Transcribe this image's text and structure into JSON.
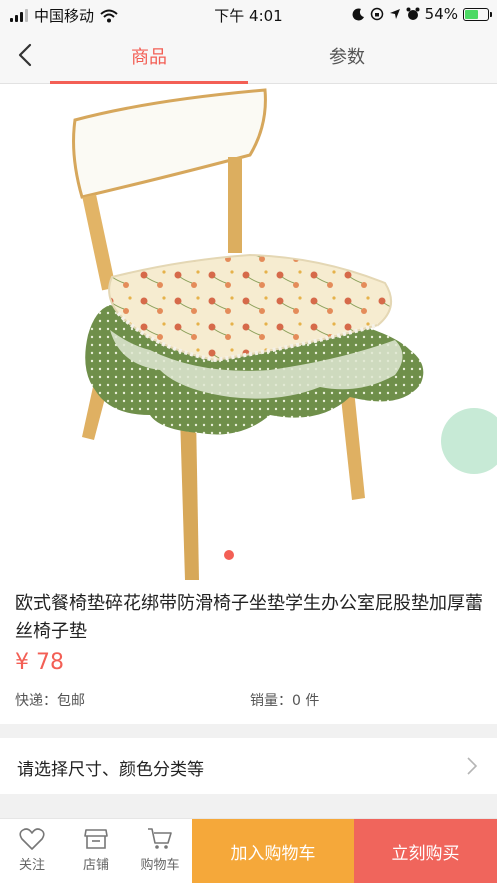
{
  "status_bar": {
    "carrier": "中国移动",
    "time": "下午 4:01",
    "battery": "54%",
    "battery_level": 0.54,
    "icons": [
      "signal-icon",
      "wifi-icon",
      "moon-icon",
      "lock-rotation-icon",
      "location-icon",
      "alarm-icon",
      "battery-icon"
    ]
  },
  "nav": {
    "tabs": [
      {
        "label": "商品",
        "active": true
      },
      {
        "label": "参数",
        "active": false
      }
    ]
  },
  "product": {
    "title": "欧式餐椅垫碎花绑带防滑椅子坐垫学生办公室屁股垫加厚蕾丝椅子垫",
    "price": "¥ 78",
    "shipping": "快递：包邮",
    "sales": "销量：0 件",
    "image_count_indicator": 1
  },
  "spec_selector": {
    "label": "请选择尺寸、颜色分类等"
  },
  "bottom_bar": {
    "follow": "关注",
    "shop": "店铺",
    "cart": "购物车",
    "add_to_cart": "加入购物车",
    "buy_now": "立刻购买"
  },
  "colors": {
    "accent": "#f35f55",
    "add_to_cart_bg": "#f5a83a",
    "buy_now_bg": "#f0655c"
  }
}
